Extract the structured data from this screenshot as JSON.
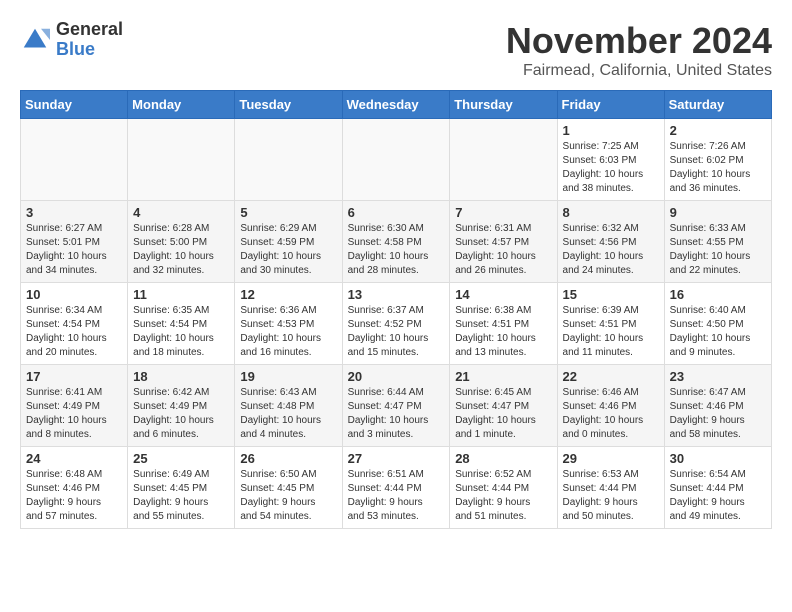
{
  "logo": {
    "general": "General",
    "blue": "Blue"
  },
  "title": "November 2024",
  "location": "Fairmead, California, United States",
  "weekdays": [
    "Sunday",
    "Monday",
    "Tuesday",
    "Wednesday",
    "Thursday",
    "Friday",
    "Saturday"
  ],
  "weeks": [
    [
      {
        "day": "",
        "info": ""
      },
      {
        "day": "",
        "info": ""
      },
      {
        "day": "",
        "info": ""
      },
      {
        "day": "",
        "info": ""
      },
      {
        "day": "",
        "info": ""
      },
      {
        "day": "1",
        "info": "Sunrise: 7:25 AM\nSunset: 6:03 PM\nDaylight: 10 hours\nand 38 minutes."
      },
      {
        "day": "2",
        "info": "Sunrise: 7:26 AM\nSunset: 6:02 PM\nDaylight: 10 hours\nand 36 minutes."
      }
    ],
    [
      {
        "day": "3",
        "info": "Sunrise: 6:27 AM\nSunset: 5:01 PM\nDaylight: 10 hours\nand 34 minutes."
      },
      {
        "day": "4",
        "info": "Sunrise: 6:28 AM\nSunset: 5:00 PM\nDaylight: 10 hours\nand 32 minutes."
      },
      {
        "day": "5",
        "info": "Sunrise: 6:29 AM\nSunset: 4:59 PM\nDaylight: 10 hours\nand 30 minutes."
      },
      {
        "day": "6",
        "info": "Sunrise: 6:30 AM\nSunset: 4:58 PM\nDaylight: 10 hours\nand 28 minutes."
      },
      {
        "day": "7",
        "info": "Sunrise: 6:31 AM\nSunset: 4:57 PM\nDaylight: 10 hours\nand 26 minutes."
      },
      {
        "day": "8",
        "info": "Sunrise: 6:32 AM\nSunset: 4:56 PM\nDaylight: 10 hours\nand 24 minutes."
      },
      {
        "day": "9",
        "info": "Sunrise: 6:33 AM\nSunset: 4:55 PM\nDaylight: 10 hours\nand 22 minutes."
      }
    ],
    [
      {
        "day": "10",
        "info": "Sunrise: 6:34 AM\nSunset: 4:54 PM\nDaylight: 10 hours\nand 20 minutes."
      },
      {
        "day": "11",
        "info": "Sunrise: 6:35 AM\nSunset: 4:54 PM\nDaylight: 10 hours\nand 18 minutes."
      },
      {
        "day": "12",
        "info": "Sunrise: 6:36 AM\nSunset: 4:53 PM\nDaylight: 10 hours\nand 16 minutes."
      },
      {
        "day": "13",
        "info": "Sunrise: 6:37 AM\nSunset: 4:52 PM\nDaylight: 10 hours\nand 15 minutes."
      },
      {
        "day": "14",
        "info": "Sunrise: 6:38 AM\nSunset: 4:51 PM\nDaylight: 10 hours\nand 13 minutes."
      },
      {
        "day": "15",
        "info": "Sunrise: 6:39 AM\nSunset: 4:51 PM\nDaylight: 10 hours\nand 11 minutes."
      },
      {
        "day": "16",
        "info": "Sunrise: 6:40 AM\nSunset: 4:50 PM\nDaylight: 10 hours\nand 9 minutes."
      }
    ],
    [
      {
        "day": "17",
        "info": "Sunrise: 6:41 AM\nSunset: 4:49 PM\nDaylight: 10 hours\nand 8 minutes."
      },
      {
        "day": "18",
        "info": "Sunrise: 6:42 AM\nSunset: 4:49 PM\nDaylight: 10 hours\nand 6 minutes."
      },
      {
        "day": "19",
        "info": "Sunrise: 6:43 AM\nSunset: 4:48 PM\nDaylight: 10 hours\nand 4 minutes."
      },
      {
        "day": "20",
        "info": "Sunrise: 6:44 AM\nSunset: 4:47 PM\nDaylight: 10 hours\nand 3 minutes."
      },
      {
        "day": "21",
        "info": "Sunrise: 6:45 AM\nSunset: 4:47 PM\nDaylight: 10 hours\nand 1 minute."
      },
      {
        "day": "22",
        "info": "Sunrise: 6:46 AM\nSunset: 4:46 PM\nDaylight: 10 hours\nand 0 minutes."
      },
      {
        "day": "23",
        "info": "Sunrise: 6:47 AM\nSunset: 4:46 PM\nDaylight: 9 hours\nand 58 minutes."
      }
    ],
    [
      {
        "day": "24",
        "info": "Sunrise: 6:48 AM\nSunset: 4:46 PM\nDaylight: 9 hours\nand 57 minutes."
      },
      {
        "day": "25",
        "info": "Sunrise: 6:49 AM\nSunset: 4:45 PM\nDaylight: 9 hours\nand 55 minutes."
      },
      {
        "day": "26",
        "info": "Sunrise: 6:50 AM\nSunset: 4:45 PM\nDaylight: 9 hours\nand 54 minutes."
      },
      {
        "day": "27",
        "info": "Sunrise: 6:51 AM\nSunset: 4:44 PM\nDaylight: 9 hours\nand 53 minutes."
      },
      {
        "day": "28",
        "info": "Sunrise: 6:52 AM\nSunset: 4:44 PM\nDaylight: 9 hours\nand 51 minutes."
      },
      {
        "day": "29",
        "info": "Sunrise: 6:53 AM\nSunset: 4:44 PM\nDaylight: 9 hours\nand 50 minutes."
      },
      {
        "day": "30",
        "info": "Sunrise: 6:54 AM\nSunset: 4:44 PM\nDaylight: 9 hours\nand 49 minutes."
      }
    ]
  ]
}
